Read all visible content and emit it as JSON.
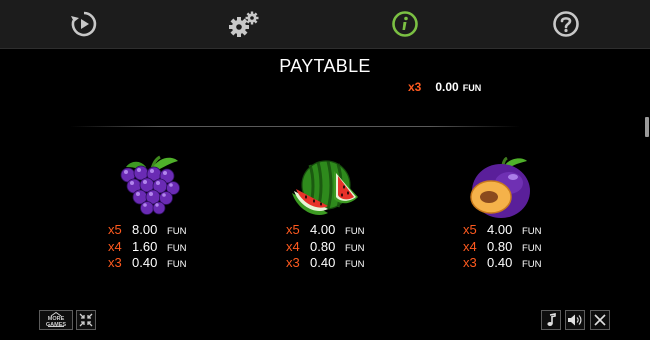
{
  "toolbar": {
    "icons": [
      "replay-icon",
      "settings-gears-icon",
      "info-icon",
      "help-icon"
    ],
    "active_color": "#7bc043",
    "icon_color": "#c8c8c8"
  },
  "title": "PAYTABLE",
  "partial_row": {
    "mult": "x3",
    "value": "0.00",
    "unit": "FUN"
  },
  "symbols": [
    {
      "name": "grapes",
      "payouts": [
        {
          "mult": "x5",
          "value": "8.00",
          "unit": "FUN"
        },
        {
          "mult": "x4",
          "value": "1.60",
          "unit": "FUN"
        },
        {
          "mult": "x3",
          "value": "0.40",
          "unit": "FUN"
        }
      ]
    },
    {
      "name": "watermelon",
      "payouts": [
        {
          "mult": "x5",
          "value": "4.00",
          "unit": "FUN"
        },
        {
          "mult": "x4",
          "value": "0.80",
          "unit": "FUN"
        },
        {
          "mult": "x3",
          "value": "0.40",
          "unit": "FUN"
        }
      ]
    },
    {
      "name": "plum",
      "payouts": [
        {
          "mult": "x5",
          "value": "4.00",
          "unit": "FUN"
        },
        {
          "mult": "x4",
          "value": "0.80",
          "unit": "FUN"
        },
        {
          "mult": "x3",
          "value": "0.40",
          "unit": "FUN"
        }
      ]
    }
  ],
  "bottom": {
    "more_games_label": "MORE GAMES",
    "left_icons": [
      "more-games-icon",
      "fullscreen-collapse-icon"
    ],
    "right_icons": [
      "music-note-icon",
      "speaker-icon",
      "close-icon"
    ]
  },
  "colors": {
    "multiplier": "#ff5a1f",
    "background": "#000000",
    "toolbar_bg": "#1c1c1c"
  }
}
